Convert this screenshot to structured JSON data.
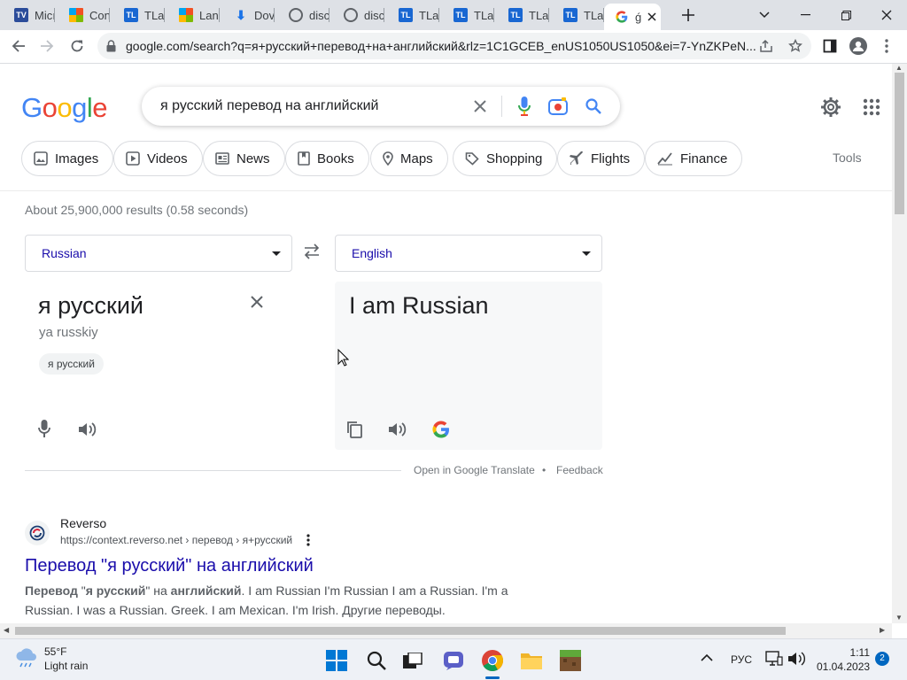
{
  "browser": {
    "tabs": [
      {
        "label": "Micı",
        "icon": "tradingview-favicon",
        "type": "tv"
      },
      {
        "label": "Con",
        "icon": "microsoft-favicon",
        "type": "ms"
      },
      {
        "label": "TLa",
        "icon": "tl-favicon",
        "type": "tl"
      },
      {
        "label": "Lanı",
        "icon": "microsoft-favicon",
        "type": "ms"
      },
      {
        "label": "Dov",
        "icon": "download-icon",
        "type": "dl"
      },
      {
        "label": "disc",
        "icon": "globe-icon",
        "type": "globe"
      },
      {
        "label": "disc",
        "icon": "globe-icon",
        "type": "globe"
      },
      {
        "label": "TLa",
        "icon": "tl-favicon",
        "type": "tl"
      },
      {
        "label": "TLa",
        "icon": "tl-favicon",
        "type": "tl"
      },
      {
        "label": "TLa",
        "icon": "tl-favicon",
        "type": "tl"
      },
      {
        "label": "TLa",
        "icon": "tl-favicon",
        "type": "tl"
      },
      {
        "label": "ǵ",
        "icon": "google-favicon",
        "type": "google",
        "active": true
      }
    ],
    "url": "google.com/search?q=я+русский+перевод+на+английский&rlz=1C1GCEB_enUS1050US1050&ei=7-YnZKPeN..."
  },
  "google": {
    "logo": [
      "G",
      "o",
      "o",
      "g",
      "l",
      "e"
    ],
    "logo_colors": [
      "#4285f4",
      "#ea4335",
      "#fbbc05",
      "#4285f4",
      "#34a853",
      "#ea4335"
    ],
    "query": "я русский перевод на английский",
    "chips": [
      "Images",
      "Videos",
      "News",
      "Books",
      "Maps",
      "Shopping",
      "Flights",
      "Finance"
    ],
    "tools": "Tools",
    "stats": "About 25,900,000 results (0.58 seconds)"
  },
  "translate": {
    "source_lang": "Russian",
    "target_lang": "English",
    "source_text": "я русский",
    "transliteration": "ya russkiy",
    "source_chip": "я русский",
    "target_text": "I am Russian",
    "open_link": "Open in Google Translate",
    "separator": "•",
    "feedback": "Feedback"
  },
  "result": {
    "site": "Reverso",
    "cite": "https://context.reverso.net › перевод › я+русский",
    "title": "Перевод \"я русский\" на английский",
    "snippet_parts": [
      {
        "b": true,
        "t": "Перевод"
      },
      {
        "b": false,
        "t": " \""
      },
      {
        "b": true,
        "t": "я русский"
      },
      {
        "b": false,
        "t": "\" на "
      },
      {
        "b": true,
        "t": "английский"
      },
      {
        "b": false,
        "t": ". I am Russian I'm Russian I am a Russian. I'm a Russian. I was a Russian. Greek. I am Mexican. I'm Irish. Другие переводы."
      }
    ]
  },
  "taskbar": {
    "temp": "55°F",
    "weather": "Light rain",
    "lang": "РУС",
    "time": "1:11",
    "date": "01.04.2023",
    "notifications": "2"
  }
}
